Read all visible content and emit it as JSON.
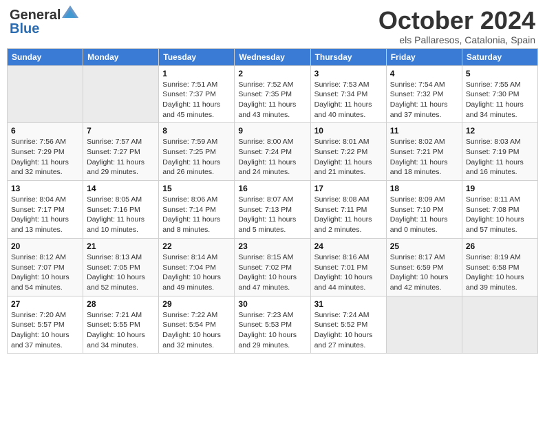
{
  "header": {
    "logo_general": "General",
    "logo_blue": "Blue",
    "month_title": "October 2024",
    "location": "els Pallaresos, Catalonia, Spain"
  },
  "columns": [
    "Sunday",
    "Monday",
    "Tuesday",
    "Wednesday",
    "Thursday",
    "Friday",
    "Saturday"
  ],
  "weeks": [
    [
      {
        "day": "",
        "info": ""
      },
      {
        "day": "",
        "info": ""
      },
      {
        "day": "1",
        "info": "Sunrise: 7:51 AM\nSunset: 7:37 PM\nDaylight: 11 hours and 45 minutes."
      },
      {
        "day": "2",
        "info": "Sunrise: 7:52 AM\nSunset: 7:35 PM\nDaylight: 11 hours and 43 minutes."
      },
      {
        "day": "3",
        "info": "Sunrise: 7:53 AM\nSunset: 7:34 PM\nDaylight: 11 hours and 40 minutes."
      },
      {
        "day": "4",
        "info": "Sunrise: 7:54 AM\nSunset: 7:32 PM\nDaylight: 11 hours and 37 minutes."
      },
      {
        "day": "5",
        "info": "Sunrise: 7:55 AM\nSunset: 7:30 PM\nDaylight: 11 hours and 34 minutes."
      }
    ],
    [
      {
        "day": "6",
        "info": "Sunrise: 7:56 AM\nSunset: 7:29 PM\nDaylight: 11 hours and 32 minutes."
      },
      {
        "day": "7",
        "info": "Sunrise: 7:57 AM\nSunset: 7:27 PM\nDaylight: 11 hours and 29 minutes."
      },
      {
        "day": "8",
        "info": "Sunrise: 7:59 AM\nSunset: 7:25 PM\nDaylight: 11 hours and 26 minutes."
      },
      {
        "day": "9",
        "info": "Sunrise: 8:00 AM\nSunset: 7:24 PM\nDaylight: 11 hours and 24 minutes."
      },
      {
        "day": "10",
        "info": "Sunrise: 8:01 AM\nSunset: 7:22 PM\nDaylight: 11 hours and 21 minutes."
      },
      {
        "day": "11",
        "info": "Sunrise: 8:02 AM\nSunset: 7:21 PM\nDaylight: 11 hours and 18 minutes."
      },
      {
        "day": "12",
        "info": "Sunrise: 8:03 AM\nSunset: 7:19 PM\nDaylight: 11 hours and 16 minutes."
      }
    ],
    [
      {
        "day": "13",
        "info": "Sunrise: 8:04 AM\nSunset: 7:17 PM\nDaylight: 11 hours and 13 minutes."
      },
      {
        "day": "14",
        "info": "Sunrise: 8:05 AM\nSunset: 7:16 PM\nDaylight: 11 hours and 10 minutes."
      },
      {
        "day": "15",
        "info": "Sunrise: 8:06 AM\nSunset: 7:14 PM\nDaylight: 11 hours and 8 minutes."
      },
      {
        "day": "16",
        "info": "Sunrise: 8:07 AM\nSunset: 7:13 PM\nDaylight: 11 hours and 5 minutes."
      },
      {
        "day": "17",
        "info": "Sunrise: 8:08 AM\nSunset: 7:11 PM\nDaylight: 11 hours and 2 minutes."
      },
      {
        "day": "18",
        "info": "Sunrise: 8:09 AM\nSunset: 7:10 PM\nDaylight: 11 hours and 0 minutes."
      },
      {
        "day": "19",
        "info": "Sunrise: 8:11 AM\nSunset: 7:08 PM\nDaylight: 10 hours and 57 minutes."
      }
    ],
    [
      {
        "day": "20",
        "info": "Sunrise: 8:12 AM\nSunset: 7:07 PM\nDaylight: 10 hours and 54 minutes."
      },
      {
        "day": "21",
        "info": "Sunrise: 8:13 AM\nSunset: 7:05 PM\nDaylight: 10 hours and 52 minutes."
      },
      {
        "day": "22",
        "info": "Sunrise: 8:14 AM\nSunset: 7:04 PM\nDaylight: 10 hours and 49 minutes."
      },
      {
        "day": "23",
        "info": "Sunrise: 8:15 AM\nSunset: 7:02 PM\nDaylight: 10 hours and 47 minutes."
      },
      {
        "day": "24",
        "info": "Sunrise: 8:16 AM\nSunset: 7:01 PM\nDaylight: 10 hours and 44 minutes."
      },
      {
        "day": "25",
        "info": "Sunrise: 8:17 AM\nSunset: 6:59 PM\nDaylight: 10 hours and 42 minutes."
      },
      {
        "day": "26",
        "info": "Sunrise: 8:19 AM\nSunset: 6:58 PM\nDaylight: 10 hours and 39 minutes."
      }
    ],
    [
      {
        "day": "27",
        "info": "Sunrise: 7:20 AM\nSunset: 5:57 PM\nDaylight: 10 hours and 37 minutes."
      },
      {
        "day": "28",
        "info": "Sunrise: 7:21 AM\nSunset: 5:55 PM\nDaylight: 10 hours and 34 minutes."
      },
      {
        "day": "29",
        "info": "Sunrise: 7:22 AM\nSunset: 5:54 PM\nDaylight: 10 hours and 32 minutes."
      },
      {
        "day": "30",
        "info": "Sunrise: 7:23 AM\nSunset: 5:53 PM\nDaylight: 10 hours and 29 minutes."
      },
      {
        "day": "31",
        "info": "Sunrise: 7:24 AM\nSunset: 5:52 PM\nDaylight: 10 hours and 27 minutes."
      },
      {
        "day": "",
        "info": ""
      },
      {
        "day": "",
        "info": ""
      }
    ]
  ]
}
